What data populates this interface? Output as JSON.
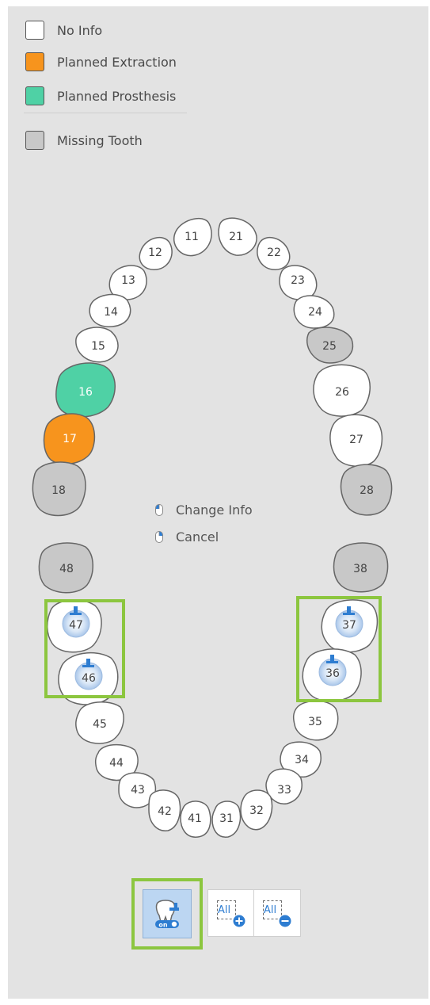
{
  "legend": {
    "items": [
      {
        "label": "No Info",
        "color": "#ffffff"
      },
      {
        "label": "Planned Extraction",
        "color": "#f7941d"
      },
      {
        "label": "Planned Prosthesis",
        "color": "#4fd1a5"
      }
    ],
    "missing": {
      "label": "Missing Tooth",
      "color": "#c8c8c8"
    }
  },
  "hints": {
    "change_info": "Change Info",
    "cancel": "Cancel"
  },
  "teeth": {
    "t11": "11",
    "t12": "12",
    "t13": "13",
    "t14": "14",
    "t15": "15",
    "t16": "16",
    "t17": "17",
    "t18": "18",
    "t21": "21",
    "t22": "22",
    "t23": "23",
    "t24": "24",
    "t25": "25",
    "t26": "26",
    "t27": "27",
    "t28": "28",
    "t31": "31",
    "t32": "32",
    "t33": "33",
    "t34": "34",
    "t35": "35",
    "t36": "36",
    "t37": "37",
    "t38": "38",
    "t41": "41",
    "t42": "42",
    "t43": "43",
    "t44": "44",
    "t45": "45",
    "t46": "46",
    "t47": "47",
    "t48": "48"
  },
  "tooth_status": {
    "16": "Planned Prosthesis",
    "17": "Planned Extraction",
    "18": "Missing Tooth",
    "25": "Missing Tooth",
    "28": "Missing Tooth",
    "38": "Missing Tooth",
    "48": "Missing Tooth"
  },
  "implant_marked": [
    "36",
    "37",
    "46",
    "47"
  ],
  "toolbar": {
    "toggle": {
      "badge": "on",
      "icon": "tooth-implant-toggle-icon",
      "active": true
    },
    "add_all": {
      "label": "All",
      "icon": "plus-circle-icon"
    },
    "remove_all": {
      "label": "All",
      "icon": "minus-circle-icon"
    }
  },
  "colors": {
    "panel": "#e3e3e3",
    "highlight": "#8cc63f",
    "accent": "#2e7dd1"
  }
}
